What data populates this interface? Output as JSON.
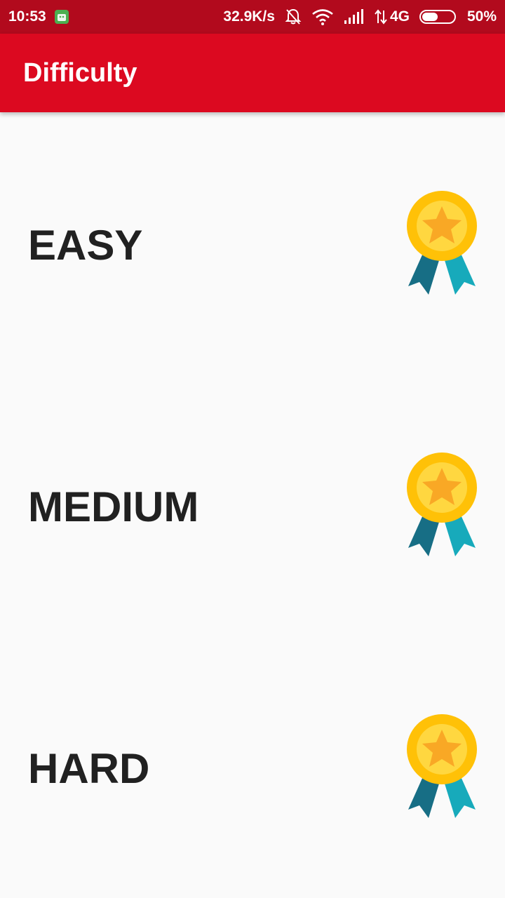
{
  "status_bar": {
    "time": "10:53",
    "network_speed": "32.9K/s",
    "network_type": "4G",
    "battery": "50%",
    "battery_level": 0.5,
    "icons": [
      "android-icon",
      "mute-bell-icon",
      "wifi-icon",
      "signal-icon",
      "data-arrows-icon",
      "battery-icon"
    ]
  },
  "app_bar": {
    "title": "Difficulty",
    "color": "#dc0920"
  },
  "difficulties": [
    {
      "label": "EASY",
      "icon": "medal-icon"
    },
    {
      "label": "MEDIUM",
      "icon": "medal-icon"
    },
    {
      "label": "HARD",
      "icon": "medal-icon"
    }
  ],
  "colors": {
    "status_bar": "#b20a1d",
    "medal_gold": "#ffc107",
    "medal_star": "#f9a825",
    "ribbon_dark": "#176e85",
    "ribbon_light": "#17aabb"
  }
}
